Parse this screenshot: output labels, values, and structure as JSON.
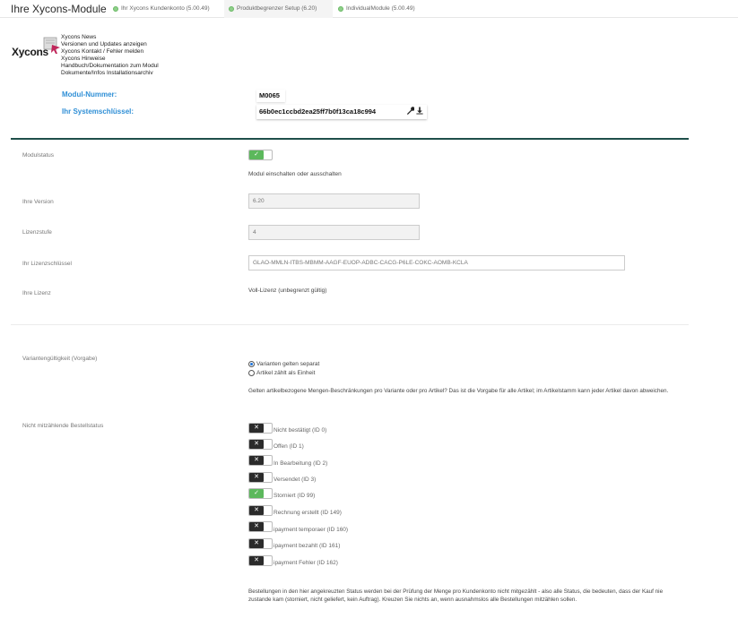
{
  "header": {
    "title": "Ihre Xycons-Module",
    "tabs": [
      {
        "label": "Ihr Xycons Kundenkonto (5.00.49)",
        "active": false
      },
      {
        "label": "Produktbegrenzer Setup (6.20)",
        "active": true
      },
      {
        "label": "IndividualModule (5.00.49)",
        "active": false
      }
    ]
  },
  "logo": {
    "text": "Xycons"
  },
  "links": [
    "Xycons News",
    "Versionen und Updates anzeigen",
    "Xycons Kontakt / Fehler melden",
    "Xycons Hinweise",
    "Handbuch/Dokumentation zum Modul",
    "Dokumente/Infos Installationsarchiv"
  ],
  "module": {
    "number_label": "Modul-Nummer:",
    "number_value": "M0065",
    "key_label": "Ihr Systemschlüssel:",
    "key_value": "66b0ec1ccbd2ea25ff7b0f13ca18c994",
    "key_icons": [
      "wrench-icon",
      "download-icon"
    ]
  },
  "settings": {
    "modulstatus": {
      "label": "Modulstatus",
      "on": true,
      "help": "Modul einschalten oder ausschalten"
    },
    "version": {
      "label": "Ihre Version",
      "value": "6.20"
    },
    "lizenzstufe": {
      "label": "Lizenzstufe",
      "value": "4"
    },
    "lizenzschluessel": {
      "label": "Ihr Lizenzschlüssel",
      "value": "GLAO-MMLN-ITBS-MBMM-AAGF-EUOP-ADBC-CACG-P6LE-COKC-AOMB-KCLA"
    },
    "lizenz": {
      "label": "Ihre Lizenz",
      "value": "Voll-Lizenz (unbegrenzt gültig)"
    },
    "varianten": {
      "label": "Variantengültigkeit (Vorgabe)",
      "options": [
        {
          "label": "Varianten gelten separat",
          "checked": true
        },
        {
          "label": "Artikel zählt als Einheit",
          "checked": false
        }
      ],
      "help": "Gelten artikelbezogene Mengen-Beschränkungen pro Variante oder pro Artikel? Das ist die Vorgabe für alle Artikel; im Artikelstamm kann jeder Artikel davon abweichen."
    },
    "bestellstatus": {
      "label": "Nicht mitzählende Bestellstatus",
      "items": [
        {
          "label": "Nicht bestätigt (ID 0)",
          "on": false
        },
        {
          "label": "Offen (ID 1)",
          "on": false
        },
        {
          "label": "In Bearbeitung (ID 2)",
          "on": false
        },
        {
          "label": "Versendet (ID 3)",
          "on": false
        },
        {
          "label": "Storniert (ID 99)",
          "on": true
        },
        {
          "label": "Rechnung erstellt (ID 149)",
          "on": false
        },
        {
          "label": "ipayment temporaer (ID 160)",
          "on": false
        },
        {
          "label": "ipayment bezahlt (ID 161)",
          "on": false
        },
        {
          "label": "ipayment Fehler (ID 162)",
          "on": false
        }
      ],
      "help": "Bestellungen in den hier angekreuzten Status werden bei der Prüfung der Menge pro Kundenkonto nicht mitgezählt - also alle Status, die bedeuten, dass der Kauf nie zustande kam (storniert, nicht geliefert, kein Auftrag). Kreuzen Sie nichts an, wenn ausnahmslos alle Bestellungen mitzählen sollen."
    }
  }
}
